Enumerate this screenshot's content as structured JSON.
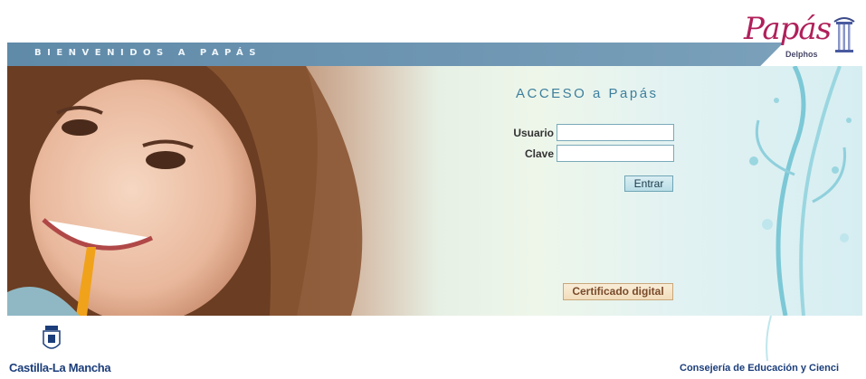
{
  "header": {
    "banner_text": "BIENVENIDOS A PAPÁS",
    "logo_text": "Papás",
    "logo_sub": "Delphos"
  },
  "login": {
    "title": "ACCESO a Papás",
    "usuario_label": "Usuario",
    "usuario_value": "",
    "clave_label": "Clave",
    "clave_value": "",
    "submit_label": "Entrar",
    "certificate_label": "Certificado digital"
  },
  "footer": {
    "region": "Castilla-La Mancha",
    "department": "Consejería de Educación y Cienci"
  },
  "colors": {
    "banner": "#6f97b3",
    "accent": "#3d7f9c",
    "logo": "#b0205a",
    "footer_text": "#1b3d7a"
  }
}
